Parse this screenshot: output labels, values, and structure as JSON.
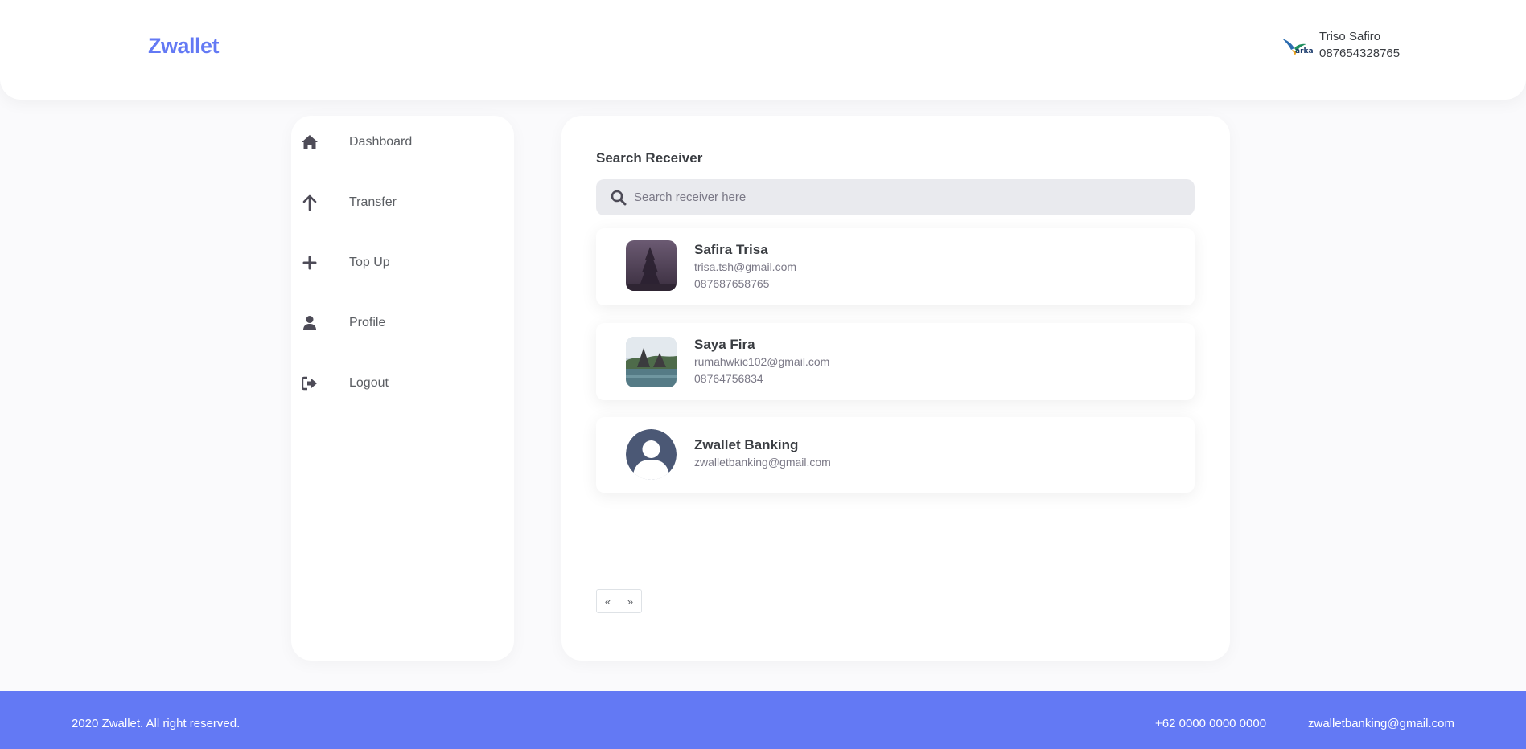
{
  "app": {
    "brand": "Zwallet",
    "accent": "#6379f4"
  },
  "user": {
    "name": "Triso Safiro",
    "phone": "087654328765",
    "avatar_icon": "hummingbird-logo-avatar"
  },
  "sidebar": {
    "items": [
      {
        "label": "Dashboard",
        "icon": "home-icon"
      },
      {
        "label": "Transfer",
        "icon": "arrow-up-icon"
      },
      {
        "label": "Top Up",
        "icon": "plus-icon"
      },
      {
        "label": "Profile",
        "icon": "user-icon"
      },
      {
        "label": "Logout",
        "icon": "logout-icon"
      }
    ]
  },
  "main": {
    "title": "Search Receiver",
    "search": {
      "placeholder": "Search receiver here",
      "value": ""
    },
    "receivers": [
      {
        "name": "Safira Trisa",
        "email": "trisa.tsh@gmail.com",
        "phone": "087687658765"
      },
      {
        "name": "Saya Fira",
        "email": "rumahwkic102@gmail.com",
        "phone": "08764756834"
      },
      {
        "name": "Zwallet Banking",
        "email": "zwalletbanking@gmail.com",
        "phone": ""
      }
    ],
    "pagination": {
      "prev": "«",
      "next": "»"
    }
  },
  "footer": {
    "copyright": "2020 Zwallet. All right reserved.",
    "phone": "+62 0000 0000 0000",
    "email": "zwalletbanking@gmail.com"
  }
}
